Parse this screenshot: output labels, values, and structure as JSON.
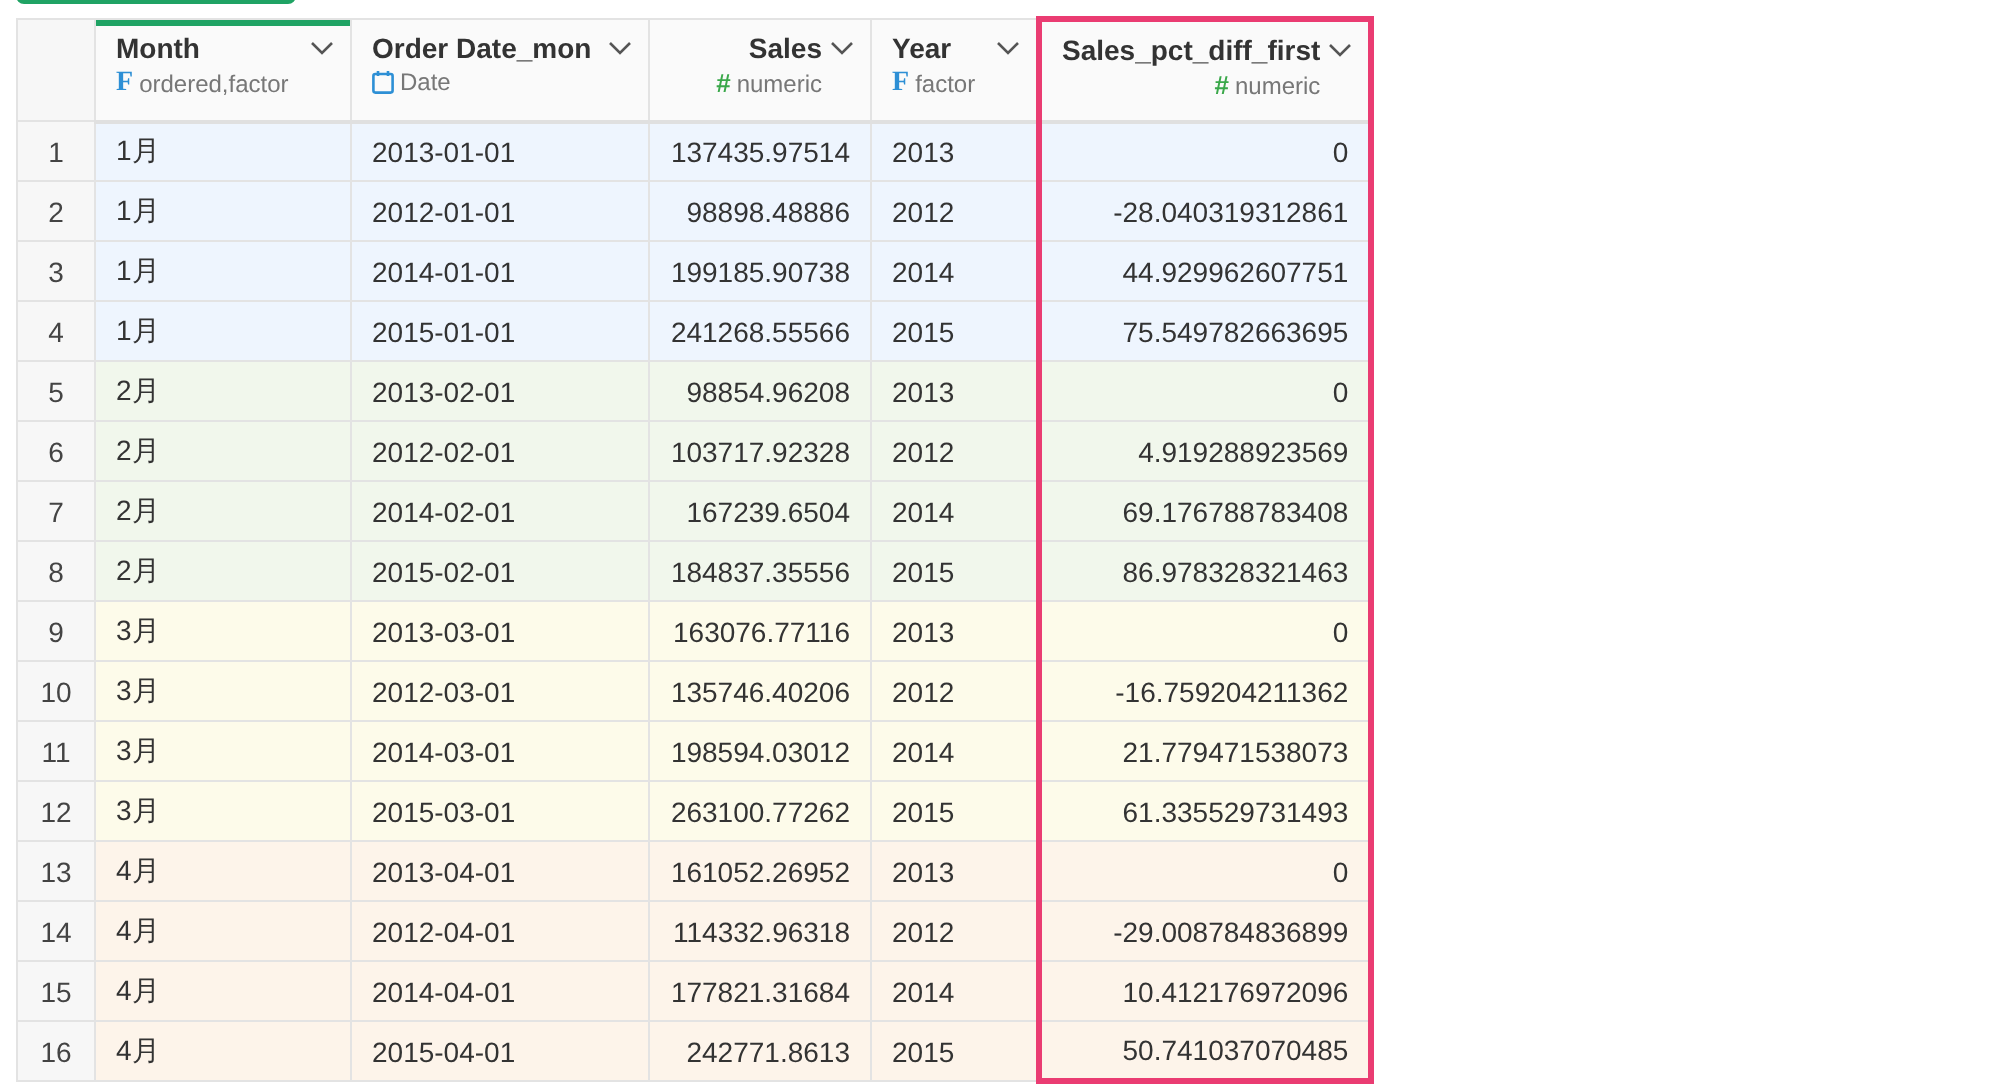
{
  "columns": [
    {
      "name": "Month",
      "type": "ordered,factor",
      "kind": "factor",
      "icon": "F",
      "selected": true,
      "highlighted": false
    },
    {
      "name": "Order Date_mon",
      "type": "Date",
      "kind": "date",
      "selected": false,
      "highlighted": false
    },
    {
      "name": "Sales",
      "type": "numeric",
      "kind": "numeric",
      "icon": "#",
      "selected": false,
      "highlighted": false
    },
    {
      "name": "Year",
      "type": "factor",
      "kind": "factor",
      "icon": "F",
      "selected": false,
      "highlighted": false
    },
    {
      "name": "Sales_pct_diff_first",
      "type": "numeric",
      "kind": "numeric",
      "icon": "#",
      "selected": false,
      "highlighted": true
    }
  ],
  "rows": [
    {
      "num": "1",
      "color": "#eef5fe",
      "cells": [
        "1月",
        "2013-01-01",
        "137435.97514",
        "2013",
        "0"
      ]
    },
    {
      "num": "2",
      "color": "#eef5fe",
      "cells": [
        "1月",
        "2012-01-01",
        "98898.48886",
        "2012",
        "-28.040319312861"
      ]
    },
    {
      "num": "3",
      "color": "#eef5fe",
      "cells": [
        "1月",
        "2014-01-01",
        "199185.90738",
        "2014",
        "44.929962607751"
      ]
    },
    {
      "num": "4",
      "color": "#eef5fe",
      "cells": [
        "1月",
        "2015-01-01",
        "241268.55566",
        "2015",
        "75.549782663695"
      ]
    },
    {
      "num": "5",
      "color": "#f1f7ec",
      "cells": [
        "2月",
        "2013-02-01",
        "98854.96208",
        "2013",
        "0"
      ]
    },
    {
      "num": "6",
      "color": "#f1f7ec",
      "cells": [
        "2月",
        "2012-02-01",
        "103717.92328",
        "2012",
        "4.919288923569"
      ]
    },
    {
      "num": "7",
      "color": "#f1f7ec",
      "cells": [
        "2月",
        "2014-02-01",
        "167239.6504",
        "2014",
        "69.176788783408"
      ]
    },
    {
      "num": "8",
      "color": "#f1f7ec",
      "cells": [
        "2月",
        "2015-02-01",
        "184837.35556",
        "2015",
        "86.978328321463"
      ]
    },
    {
      "num": "9",
      "color": "#fdfbea",
      "cells": [
        "3月",
        "2013-03-01",
        "163076.77116",
        "2013",
        "0"
      ]
    },
    {
      "num": "10",
      "color": "#fdfbea",
      "cells": [
        "3月",
        "2012-03-01",
        "135746.40206",
        "2012",
        "-16.759204211362"
      ]
    },
    {
      "num": "11",
      "color": "#fdfbea",
      "cells": [
        "3月",
        "2014-03-01",
        "198594.03012",
        "2014",
        "21.779471538073"
      ]
    },
    {
      "num": "12",
      "color": "#fdfbea",
      "cells": [
        "3月",
        "2015-03-01",
        "263100.77262",
        "2015",
        "61.335529731493"
      ]
    },
    {
      "num": "13",
      "color": "#fdf4ea",
      "cells": [
        "4月",
        "2013-04-01",
        "161052.26952",
        "2013",
        "0"
      ]
    },
    {
      "num": "14",
      "color": "#fdf4ea",
      "cells": [
        "4月",
        "2012-04-01",
        "114332.96318",
        "2012",
        "-29.008784836899"
      ]
    },
    {
      "num": "15",
      "color": "#fdf4ea",
      "cells": [
        "4月",
        "2014-04-01",
        "177821.31684",
        "2014",
        "10.412176972096"
      ]
    },
    {
      "num": "16",
      "color": "#fdf4ea",
      "cells": [
        "4月",
        "2015-04-01",
        "242771.8613",
        "2015",
        "50.741037070485"
      ]
    }
  ]
}
